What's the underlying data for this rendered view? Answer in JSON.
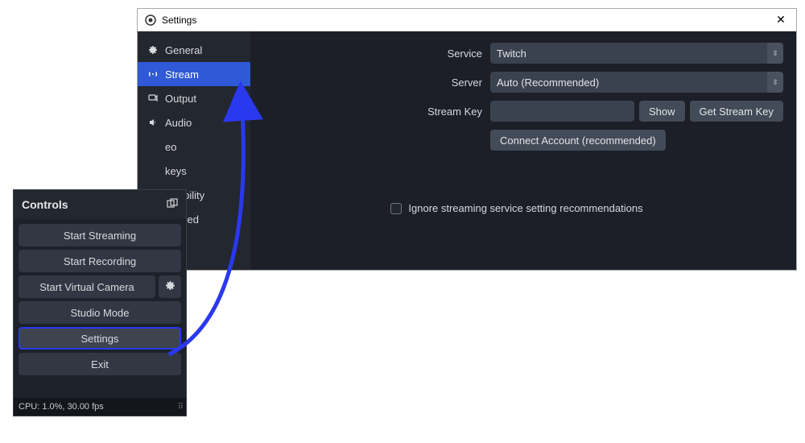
{
  "settings": {
    "title": "Settings",
    "nav": {
      "general": "General",
      "stream": "Stream",
      "output": "Output",
      "audio": "Audio",
      "video": "eo",
      "hotkeys": "keys",
      "accessibility": "essibility",
      "advanced": "vanced"
    },
    "form": {
      "service_label": "Service",
      "service_value": "Twitch",
      "server_label": "Server",
      "server_value": "Auto (Recommended)",
      "streamkey_label": "Stream Key",
      "streamkey_value": "",
      "show_btn": "Show",
      "getkey_btn": "Get Stream Key",
      "connect_btn": "Connect Account (recommended)",
      "ignore_label": "Ignore streaming service setting recommendations"
    }
  },
  "controls": {
    "title": "Controls",
    "start_streaming": "Start Streaming",
    "start_recording": "Start Recording",
    "start_virtual_cam": "Start Virtual Camera",
    "studio_mode": "Studio Mode",
    "settings": "Settings",
    "exit": "Exit",
    "footer": "CPU: 1.0%, 30.00 fps"
  }
}
